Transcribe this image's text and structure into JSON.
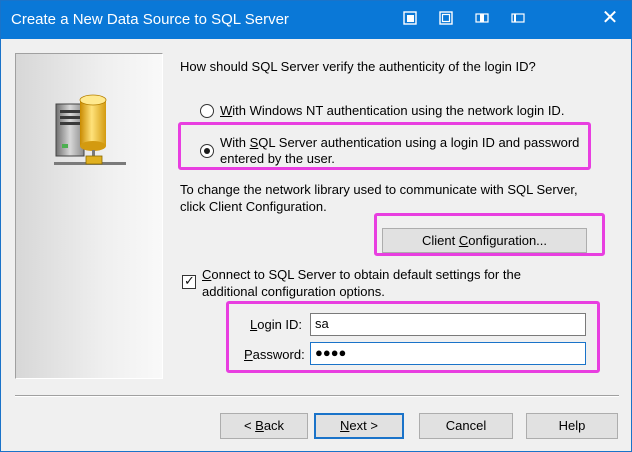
{
  "window": {
    "title": "Create a New Data Source to SQL Server",
    "close_glyph": "✕",
    "titlebar_icons": [
      "window-icon-1",
      "window-icon-2",
      "window-icon-3",
      "window-icon-4"
    ]
  },
  "question": "How should SQL Server verify the authenticity of the login ID?",
  "auth_options": [
    {
      "text_pre": "",
      "mnemonic": "W",
      "text_post": "ith Windows NT authentication using the network login ID.",
      "selected": false
    },
    {
      "text_pre": "With ",
      "mnemonic": "S",
      "text_post": "QL Server authentication using a login ID and password",
      "line2": "entered by the user.",
      "selected": true
    }
  ],
  "network_hint": {
    "line1": "To change the network library used to communicate with SQL Server,",
    "line2": "click Client Configuration."
  },
  "client_config_button": {
    "text_pre": "Client ",
    "mnemonic": "C",
    "text_post": "onfiguration..."
  },
  "connect_option": {
    "checked": true,
    "text_pre": "",
    "mnemonic": "C",
    "text_post": "onnect to SQL Server to obtain default settings for the",
    "line2": "additional configuration options."
  },
  "login_id": {
    "label_pre": "",
    "mnemonic": "L",
    "label_post": "ogin ID:",
    "value": "sa"
  },
  "password": {
    "label_pre": "",
    "mnemonic": "P",
    "label_post": "assword:",
    "value": "●●●●"
  },
  "buttons": {
    "back": {
      "text_pre": "< ",
      "mnemonic": "B",
      "text_post": "ack"
    },
    "next": {
      "text_pre": "",
      "mnemonic": "N",
      "text_post": "ext >"
    },
    "cancel": "Cancel",
    "help": "Help"
  },
  "colors": {
    "accent": "#0a78d7",
    "highlight": "#e83ee0",
    "dialog_bg": "#f0f0f0"
  }
}
